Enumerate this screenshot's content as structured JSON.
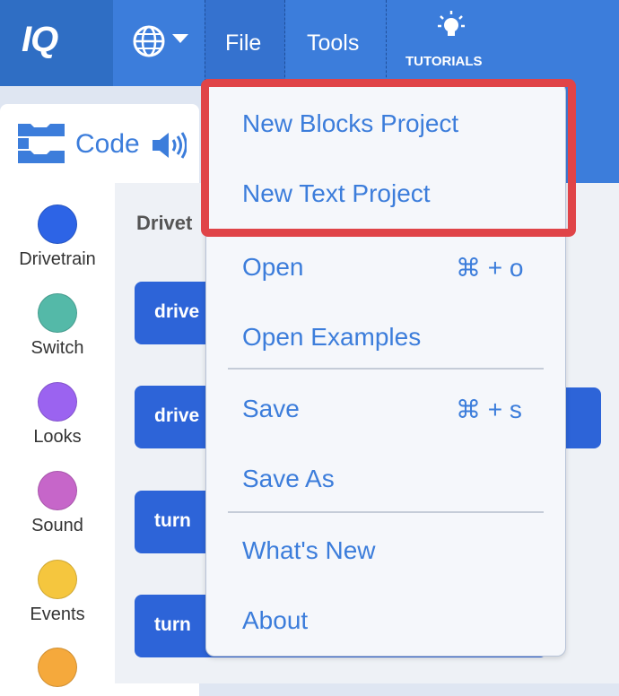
{
  "header": {
    "logo": "IQ",
    "menus": {
      "file": "File",
      "tools": "Tools",
      "tutorials": "TUTORIALS"
    }
  },
  "left_panel": {
    "tab_label": "Code",
    "categories": [
      {
        "label": "Drivetrain",
        "color": "#2d64e6"
      },
      {
        "label": "Switch",
        "color": "#54b9a8"
      },
      {
        "label": "Looks",
        "color": "#9b63f0"
      },
      {
        "label": "Sound",
        "color": "#c666c9"
      },
      {
        "label": "Events",
        "color": "#f5c63e"
      },
      {
        "label": "",
        "color": "#f5a93c"
      }
    ]
  },
  "workspace": {
    "title": "Drivet",
    "blocks": [
      "drive",
      "drive",
      "turn",
      "turn"
    ]
  },
  "file_menu": {
    "new_blocks": "New Blocks Project",
    "new_text": "New Text Project",
    "open": "Open",
    "open_shortcut": "⌘ + o",
    "open_examples": "Open Examples",
    "save": "Save",
    "save_shortcut": "⌘ + s",
    "save_as": "Save As",
    "whats_new": "What's New",
    "about": "About"
  },
  "colors": {
    "accent": "#3c7ddb",
    "highlight": "#e04448"
  }
}
